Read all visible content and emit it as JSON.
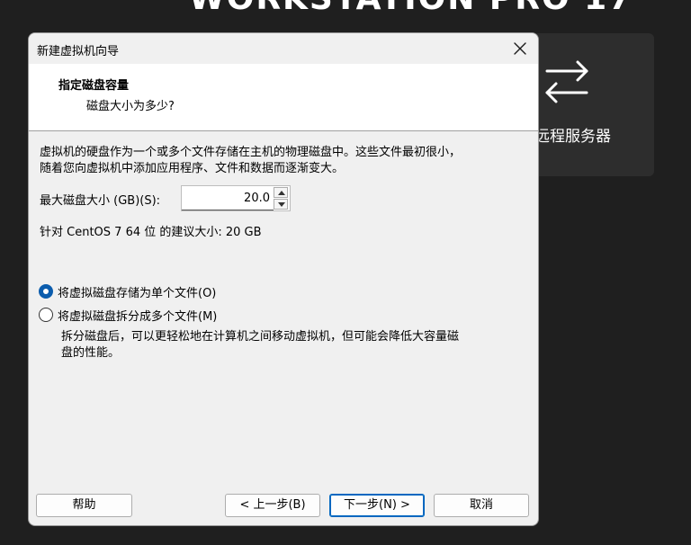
{
  "background": {
    "title": "WORKSTATION PRO 17",
    "card_label": "远程服务器",
    "card_icon": "transfer-arrows-icon"
  },
  "dialog": {
    "window_title": "新建虚拟机向导",
    "close_icon": "close-icon",
    "header_title": "指定磁盘容量",
    "header_subtitle": "磁盘大小为多少?",
    "description_line1": "虚拟机的硬盘作为一个或多个文件存储在主机的物理磁盘中。这些文件最初很小，",
    "description_line2": "随着您向虚拟机中添加应用程序、文件和数据而逐渐变大。",
    "max_size_label": "最大磁盘大小 (GB)(S):",
    "max_size_value": "20.0",
    "recommendation": "针对 CentOS 7 64 位 的建议大小: 20 GB",
    "radio_single": "将虚拟磁盘存储为单个文件(O)",
    "radio_split": "将虚拟磁盘拆分成多个文件(M)",
    "selected_option": "single",
    "split_note_line1": "拆分磁盘后，可以更轻松地在计算机之间移动虚拟机，但可能会降低大容量磁",
    "split_note_line2": "盘的性能。"
  },
  "buttons": {
    "help": "帮助",
    "back": "< 上一步(B)",
    "next": "下一步(N) >",
    "cancel": "取消"
  },
  "colors": {
    "accent": "#0067c0",
    "background": "#1f1f1f",
    "dialog": "#f0f0f0"
  }
}
